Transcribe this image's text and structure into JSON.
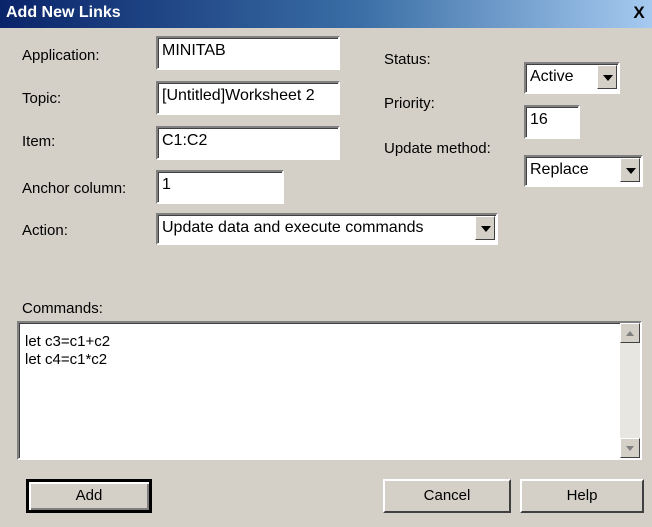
{
  "window": {
    "title": "Add New Links",
    "close_label": "X"
  },
  "labels": {
    "application": "Application:",
    "topic": "Topic:",
    "item": "Item:",
    "anchor_column": "Anchor column:",
    "action": "Action:",
    "commands": "Commands:",
    "status": "Status:",
    "priority": "Priority:",
    "update_method": "Update method:"
  },
  "fields": {
    "application": "MINITAB",
    "topic": "[Untitled]Worksheet 2",
    "item": "C1:C2",
    "anchor_column": "1",
    "priority": "16"
  },
  "combos": {
    "status": "Active",
    "update_method": "Replace",
    "action": "Update data and execute commands"
  },
  "commands": [
    "let c3=c1+c2",
    "let c4=c1*c2"
  ],
  "buttons": {
    "add": "Add",
    "cancel": "Cancel",
    "help": "Help"
  },
  "icons": {
    "dropdown": "chevron-down-icon",
    "scroll_up": "scroll-up-icon",
    "scroll_down": "scroll-down-icon",
    "close": "close-icon"
  }
}
